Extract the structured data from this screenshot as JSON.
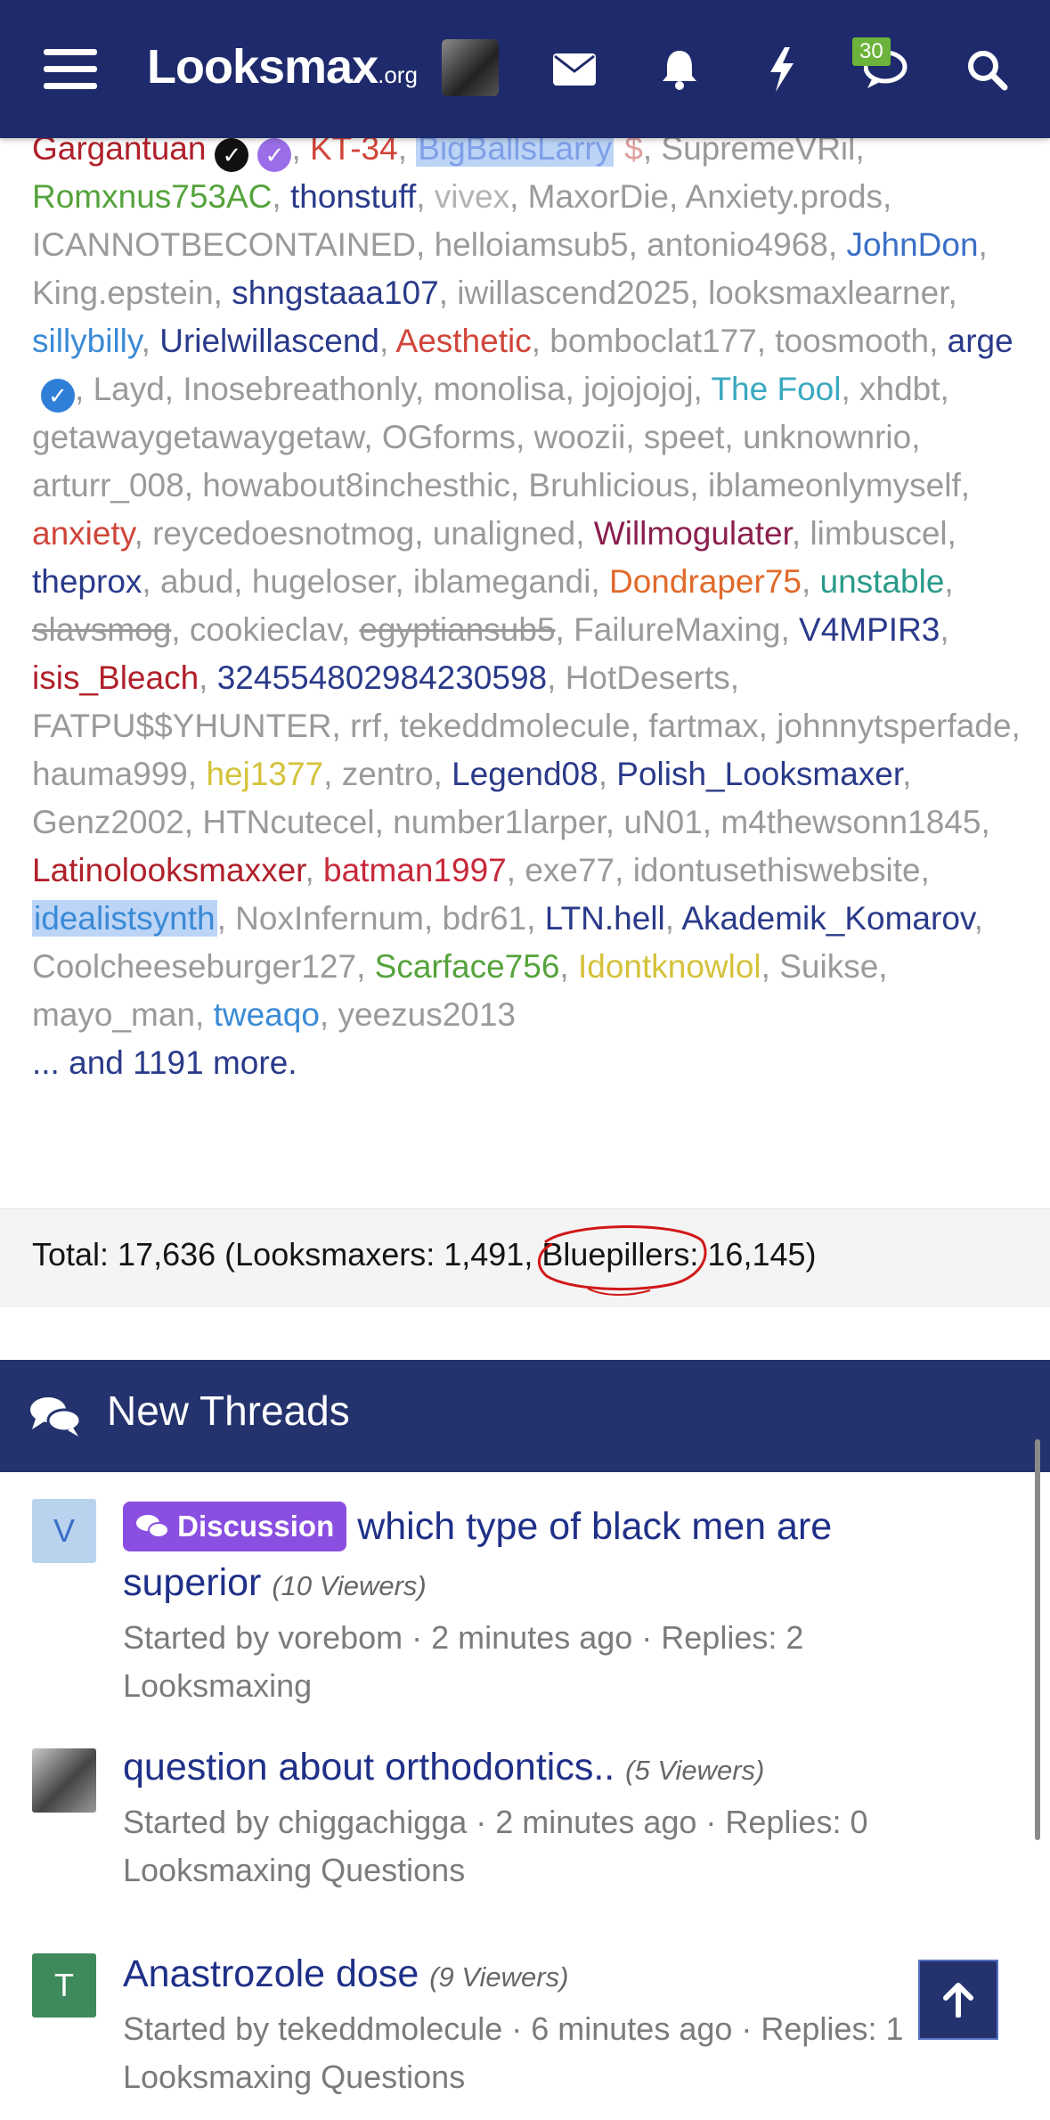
{
  "nav": {
    "logo_main": "Looksmax",
    "logo_org": ".org",
    "messages_badge": "30",
    "icons": [
      "menu-icon",
      "envelope-icon",
      "bell-icon",
      "lightning-icon",
      "chat-icon",
      "search-icon"
    ]
  },
  "online": {
    "users": [
      {
        "name": "Gargantuan",
        "color": "#b0202a",
        "badges": [
          "black",
          "purple"
        ]
      },
      {
        "name": "KT-34",
        "color": "#d0453a"
      },
      {
        "name": "BigBallsLarry",
        "color": "#7fa0e8",
        "highlight": true,
        "badge_text": "$"
      },
      {
        "name": "SupremeVRil",
        "color": "#9a9a9a"
      },
      {
        "name": "Romxnus753AC",
        "color": "#55a33c"
      },
      {
        "name": "thonstuff",
        "color": "#2a3a8a"
      },
      {
        "name": "vivex",
        "color": "#b3b3b3"
      },
      {
        "name": "MaxorDie",
        "color": "#9a9a9a"
      },
      {
        "name": "Anxiety.prods",
        "color": "#9a9a9a"
      },
      {
        "name": "ICANNOTBECONTAINED",
        "color": "#9a9a9a"
      },
      {
        "name": "helloiamsub5",
        "color": "#9a9a9a"
      },
      {
        "name": "antonio4968",
        "color": "#9a9a9a"
      },
      {
        "name": "JohnDon",
        "color": "#3a6fc6"
      },
      {
        "name": "King.epstein",
        "color": "#9a9a9a"
      },
      {
        "name": "shngstaaa107",
        "color": "#2a3a8a"
      },
      {
        "name": "iwillascend2025",
        "color": "#9a9a9a"
      },
      {
        "name": "looksmaxlearner",
        "color": "#9a9a9a"
      },
      {
        "name": "sillybilly",
        "color": "#3a8ad6"
      },
      {
        "name": "Urielwillascend",
        "color": "#2a3a8a"
      },
      {
        "name": "Aesthetic",
        "color": "#d0453a"
      },
      {
        "name": "bomboclat177",
        "color": "#9a9a9a"
      },
      {
        "name": "toosmooth",
        "color": "#9a9a9a"
      },
      {
        "name": "arge",
        "color": "#2a3a8a",
        "badges": [
          "blue"
        ]
      },
      {
        "name": "Layd",
        "color": "#9a9a9a"
      },
      {
        "name": "Inosebreathonly",
        "color": "#9a9a9a"
      },
      {
        "name": "monolisa",
        "color": "#9a9a9a"
      },
      {
        "name": "jojojojoj",
        "color": "#9a9a9a"
      },
      {
        "name": "The Fool",
        "color": "#3aa8c0"
      },
      {
        "name": "xhdbt",
        "color": "#9a9a9a"
      },
      {
        "name": "getawaygetawaygetaw",
        "color": "#9a9a9a"
      },
      {
        "name": "OGforms",
        "color": "#9a9a9a"
      },
      {
        "name": "woozii",
        "color": "#9a9a9a"
      },
      {
        "name": "speet",
        "color": "#9a9a9a"
      },
      {
        "name": "unknownrio",
        "color": "#9a9a9a"
      },
      {
        "name": "arturr_008",
        "color": "#9a9a9a"
      },
      {
        "name": "howabout8inchesthic",
        "color": "#9a9a9a"
      },
      {
        "name": "Bruhlicious",
        "color": "#9a9a9a"
      },
      {
        "name": "iblameonlymyself",
        "color": "#9a9a9a"
      },
      {
        "name": "anxiety",
        "color": "#d0453a"
      },
      {
        "name": "reycedoesnotmog",
        "color": "#9a9a9a"
      },
      {
        "name": "unaligned",
        "color": "#9a9a9a"
      },
      {
        "name": "Willmogulater",
        "color": "#8a1f4e"
      },
      {
        "name": "limbuscel",
        "color": "#9a9a9a"
      },
      {
        "name": "theprox",
        "color": "#2a3a8a"
      },
      {
        "name": "abud",
        "color": "#9a9a9a"
      },
      {
        "name": "hugeloser",
        "color": "#9a9a9a"
      },
      {
        "name": "iblamegandi",
        "color": "#9a9a9a"
      },
      {
        "name": "Dondraper75",
        "color": "#e06a2a"
      },
      {
        "name": "unstable",
        "color": "#2a9a8a"
      },
      {
        "name": "slavsmog",
        "color": "#9a9a9a",
        "strike": true
      },
      {
        "name": "cookieclav",
        "color": "#9a9a9a"
      },
      {
        "name": "egyptiansub5",
        "color": "#9a9a9a",
        "strike": true
      },
      {
        "name": "FailureMaxing",
        "color": "#9a9a9a"
      },
      {
        "name": "V4MPIR3",
        "color": "#2a3a8a"
      },
      {
        "name": "isis_Bleach",
        "color": "#b0202a"
      },
      {
        "name": "324554802984230598",
        "color": "#2a3a8a"
      },
      {
        "name": "HotDeserts",
        "color": "#9a9a9a"
      },
      {
        "name": "FATPU$$YHUNTER",
        "color": "#9a9a9a"
      },
      {
        "name": "rrf",
        "color": "#9a9a9a"
      },
      {
        "name": "tekeddmolecule",
        "color": "#9a9a9a"
      },
      {
        "name": "fartmax",
        "color": "#9a9a9a"
      },
      {
        "name": "johnnytsperfade",
        "color": "#9a9a9a"
      },
      {
        "name": "hauma999",
        "color": "#9a9a9a"
      },
      {
        "name": "hej1377",
        "color": "#d4c23a"
      },
      {
        "name": "zentro",
        "color": "#9a9a9a"
      },
      {
        "name": "Legend08",
        "color": "#2a3a8a"
      },
      {
        "name": "Polish_Looksmaxer",
        "color": "#2a3a8a"
      },
      {
        "name": "Genz2002",
        "color": "#9a9a9a"
      },
      {
        "name": "HTNcutecel",
        "color": "#9a9a9a"
      },
      {
        "name": "number1larper",
        "color": "#9a9a9a"
      },
      {
        "name": "uN01",
        "color": "#9a9a9a"
      },
      {
        "name": "m4thewsonn1845",
        "color": "#9a9a9a"
      },
      {
        "name": "Latinolooksmaxxer",
        "color": "#b0202a"
      },
      {
        "name": "batman1997",
        "color": "#c8283a"
      },
      {
        "name": "exe77",
        "color": "#9a9a9a"
      },
      {
        "name": "idontusethiswebsite",
        "color": "#9a9a9a"
      },
      {
        "name": "idealistsynth",
        "color": "#3a8ad6",
        "highlight": true
      },
      {
        "name": "NoxInfernum",
        "color": "#9a9a9a"
      },
      {
        "name": "bdr61",
        "color": "#9a9a9a"
      },
      {
        "name": "LTN.hell",
        "color": "#2a3a8a"
      },
      {
        "name": "Akademik_Komarov",
        "color": "#2a3a8a"
      },
      {
        "name": "Coolcheeseburger127",
        "color": "#9a9a9a"
      },
      {
        "name": "Scarface756",
        "color": "#55a33c"
      },
      {
        "name": "Idontknowlol",
        "color": "#d4c23a"
      },
      {
        "name": "Suikse",
        "color": "#9a9a9a"
      },
      {
        "name": "mayo_man",
        "color": "#9a9a9a"
      },
      {
        "name": "tweaqo",
        "color": "#3a8ad6"
      },
      {
        "name": "yeezus2013",
        "color": "#9a9a9a"
      }
    ],
    "more_text": "... and 1191 more.",
    "totals_text": "Total: 17,636 (Looksmaxers: 1,491, Bluepillers: 16,145)"
  },
  "threads": {
    "header": "New Threads",
    "items": [
      {
        "avatar_letter": "V",
        "avatar_color": "#b9d3ef",
        "avatar_text_color": "#3a6fc6",
        "prefix": "Discussion",
        "title": "which type of black men are superior",
        "viewers": "(10 Viewers)",
        "meta": "Started by vorebom · 2 minutes ago · Replies: 2",
        "forum": "Looksmaxing"
      },
      {
        "avatar_letter": "",
        "avatar_color": "#7a7a7a",
        "avatar_text_color": "#ffffff",
        "prefix": "",
        "title": "question about orthodontics..",
        "viewers": "(5 Viewers)",
        "meta": "Started by chiggachigga · 2 minutes ago · Replies: 0",
        "forum": "Looksmaxing Questions"
      },
      {
        "avatar_letter": "T",
        "avatar_color": "#3f8a5c",
        "avatar_text_color": "#ffffff",
        "prefix": "",
        "title": "Anastrozole dose",
        "viewers": "(9 Viewers)",
        "meta": "Started by tekeddmolecule · 6 minutes ago · Replies: 1",
        "forum": "Looksmaxing Questions"
      }
    ]
  }
}
